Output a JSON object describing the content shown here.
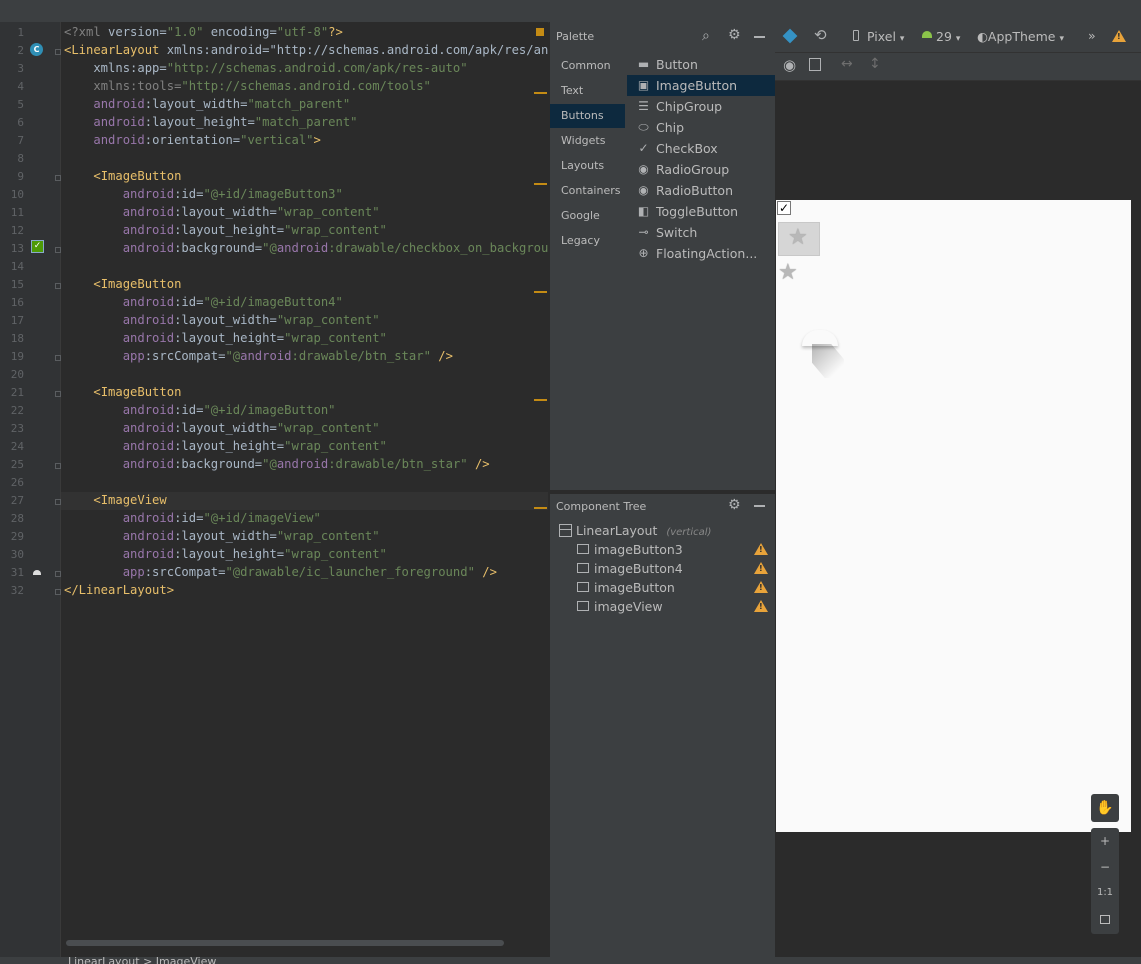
{
  "editor": {
    "line_numbers": [
      "1",
      "2",
      "3",
      "4",
      "5",
      "6",
      "7",
      "8",
      "9",
      "10",
      "11",
      "12",
      "13",
      "14",
      "15",
      "16",
      "17",
      "18",
      "19",
      "20",
      "21",
      "22",
      "23",
      "24",
      "25",
      "26",
      "27",
      "28",
      "29",
      "30",
      "31",
      "32"
    ],
    "lines": [
      [
        "<?xml version=\"1.0\" encoding=\"utf-8\"?>"
      ],
      [
        "<LinearLayout xmlns:android=\"http://schemas.android.com/apk/res/andro"
      ],
      [
        "    xmlns:app=\"http://schemas.android.com/apk/res-auto\""
      ],
      [
        "    xmlns:tools=\"http://schemas.android.com/tools\""
      ],
      [
        "    android:layout_width=\"match_parent\""
      ],
      [
        "    android:layout_height=\"match_parent\""
      ],
      [
        "    android:orientation=\"vertical\">"
      ],
      [
        ""
      ],
      [
        "    <ImageButton"
      ],
      [
        "        android:id=\"@+id/imageButton3\""
      ],
      [
        "        android:layout_width=\"wrap_content\""
      ],
      [
        "        android:layout_height=\"wrap_content\""
      ],
      [
        "        android:background=\"@android:drawable/checkbox_on_background\""
      ],
      [
        ""
      ],
      [
        "    <ImageButton"
      ],
      [
        "        android:id=\"@+id/imageButton4\""
      ],
      [
        "        android:layout_width=\"wrap_content\""
      ],
      [
        "        android:layout_height=\"wrap_content\""
      ],
      [
        "        app:srcCompat=\"@android:drawable/btn_star\" />"
      ],
      [
        ""
      ],
      [
        "    <ImageButton"
      ],
      [
        "        android:id=\"@+id/imageButton\""
      ],
      [
        "        android:layout_width=\"wrap_content\""
      ],
      [
        "        android:layout_height=\"wrap_content\""
      ],
      [
        "        android:background=\"@android:drawable/btn_star\" />"
      ],
      [
        ""
      ],
      [
        "    <ImageView"
      ],
      [
        "        android:id=\"@+id/imageView\""
      ],
      [
        "        android:layout_width=\"wrap_content\""
      ],
      [
        "        android:layout_height=\"wrap_content\""
      ],
      [
        "        app:srcCompat=\"@drawable/ic_launcher_foreground\" />"
      ],
      [
        "</LinearLayout>"
      ]
    ],
    "breadcrumb": "LinearLayout  >  ImageView"
  },
  "palette": {
    "title": "Palette",
    "categories": [
      "Common",
      "Text",
      "Buttons",
      "Widgets",
      "Layouts",
      "Containers",
      "Google",
      "Legacy"
    ],
    "selected_category": "Buttons",
    "items": [
      {
        "label": "Button",
        "icon": "button-icon"
      },
      {
        "label": "ImageButton",
        "icon": "image-button-icon"
      },
      {
        "label": "ChipGroup",
        "icon": "chipgroup-icon"
      },
      {
        "label": "Chip",
        "icon": "chip-icon"
      },
      {
        "label": "CheckBox",
        "icon": "checkmark-icon"
      },
      {
        "label": "RadioGroup",
        "icon": "radio-icon"
      },
      {
        "label": "RadioButton",
        "icon": "radio-icon"
      },
      {
        "label": "ToggleButton",
        "icon": "toggle-icon"
      },
      {
        "label": "Switch",
        "icon": "switch-icon"
      },
      {
        "label": "FloatingAction...",
        "icon": "plus-circle-icon"
      }
    ],
    "selected_item": "ImageButton"
  },
  "component_tree": {
    "title": "Component Tree",
    "root": {
      "label": "LinearLayout",
      "qualifier": "(vertical)"
    },
    "children": [
      {
        "label": "imageButton3",
        "warning": "!"
      },
      {
        "label": "imageButton4",
        "warning": "!"
      },
      {
        "label": "imageButton",
        "warning": "!"
      },
      {
        "label": "imageView",
        "warning": "!"
      }
    ]
  },
  "design_toolbar": {
    "device": "Pixel",
    "api_level": "29",
    "theme": "AppTheme",
    "overflow": "»"
  },
  "zoom_controls": {
    "plus": "+",
    "minus": "−",
    "one_to_one": "1:1"
  }
}
